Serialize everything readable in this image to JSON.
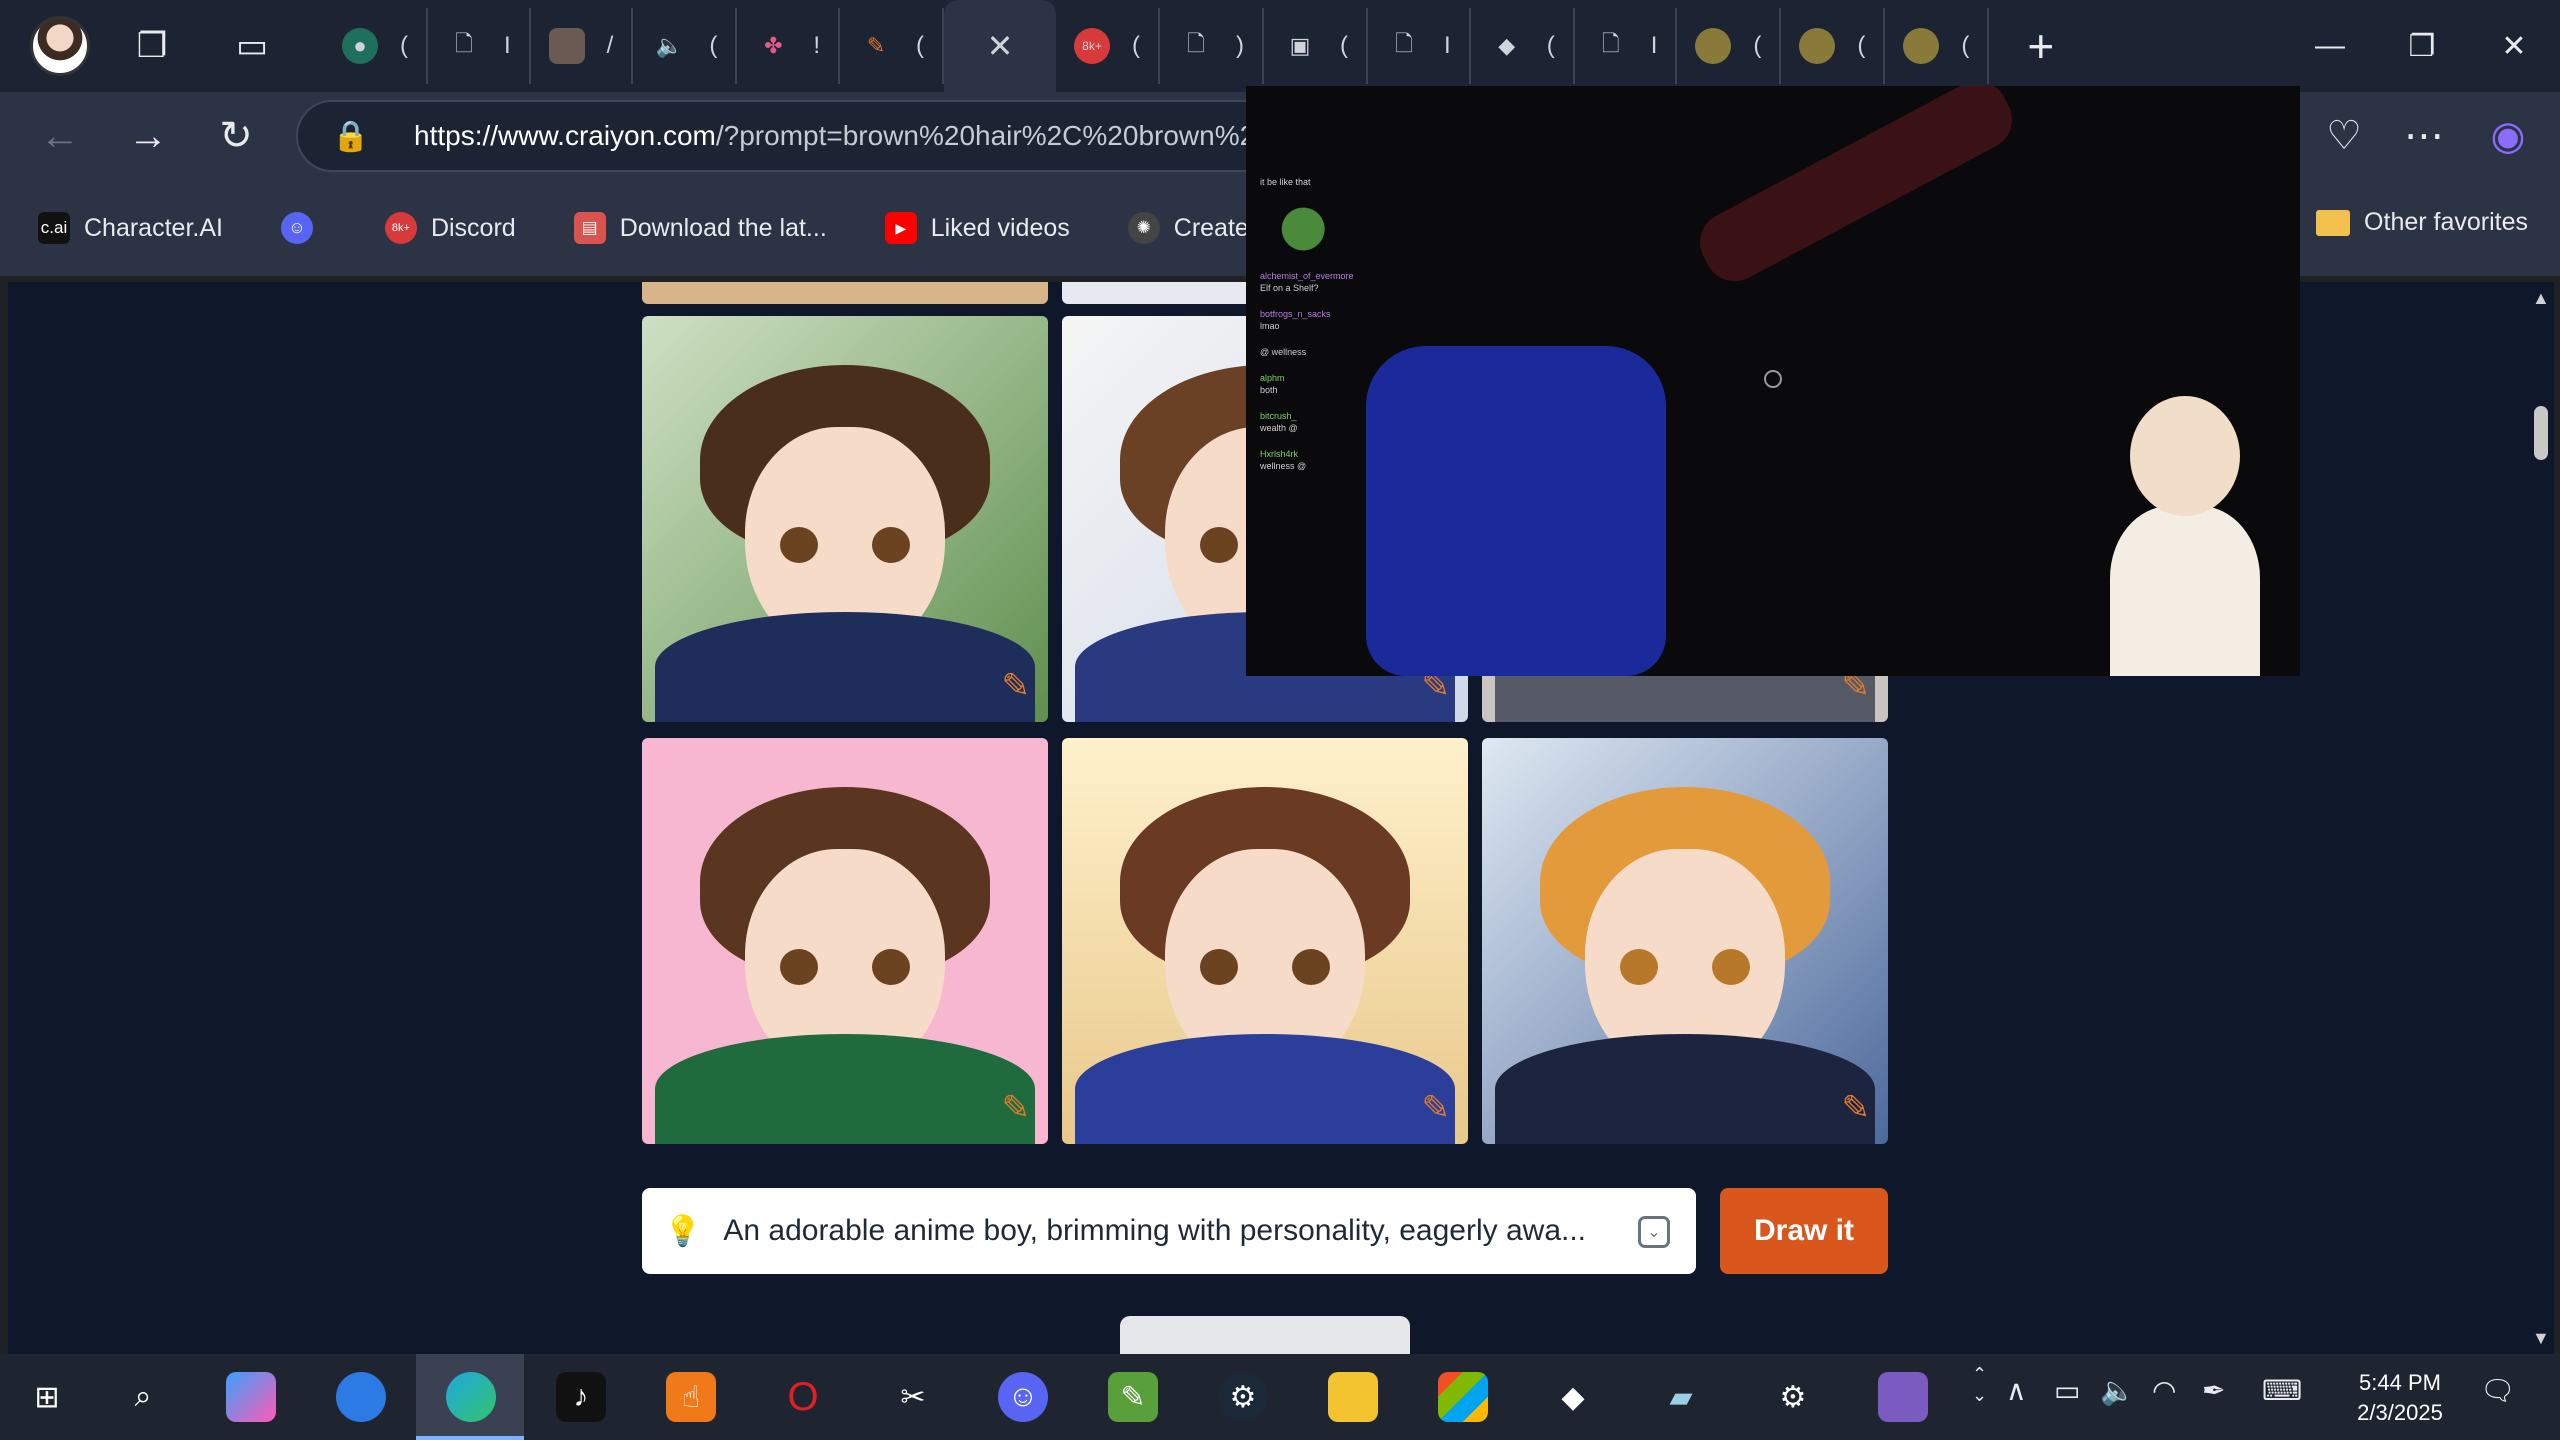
{
  "browser": {
    "tabs": [
      {
        "label": "(",
        "icon": "globe-icon"
      },
      {
        "label": "I",
        "icon": "page-icon"
      },
      {
        "label": "/",
        "icon": "image-icon"
      },
      {
        "label": "(",
        "icon": "speaker-icon"
      },
      {
        "label": "!",
        "icon": "pinwheel-icon"
      },
      {
        "label": "(",
        "icon": "pen-icon"
      },
      {
        "label": "",
        "icon": "close-icon",
        "active": true
      },
      {
        "label": "(",
        "icon": "discord-icon",
        "badge": "8k+"
      },
      {
        "label": ")",
        "icon": "page-icon"
      },
      {
        "label": "(",
        "icon": "video-icon"
      },
      {
        "label": "I",
        "icon": "page-icon"
      },
      {
        "label": "(",
        "icon": "roblox-icon"
      },
      {
        "label": "I",
        "icon": "page-icon"
      },
      {
        "label": "(",
        "icon": "mascot-icon"
      },
      {
        "label": "(",
        "icon": "mascot-icon"
      },
      {
        "label": "(",
        "icon": "mascot-icon"
      }
    ],
    "new_tab": "+",
    "url_host": "https://www.craiyon.com",
    "url_rest": "/?prompt=brown%20hair%2C%20brown%2",
    "favorites": [
      {
        "label": "Character.AI",
        "icon": "c.ai"
      },
      {
        "label": "",
        "icon": "discord-icon"
      },
      {
        "label": "Discord",
        "icon": "8k+"
      },
      {
        "label": "Download the lat...",
        "icon": "store-icon"
      },
      {
        "label": "Liked videos",
        "icon": "youtube-icon"
      },
      {
        "label": "Create Chara",
        "icon": "openai-icon"
      }
    ],
    "other_favorites": "Other favorites"
  },
  "page": {
    "prompt_text": "An adorable anime boy, brimming with personality, eagerly awa...",
    "draw_button": "Draw it"
  },
  "stream": {
    "chat": [
      {
        "user": "",
        "msg": "it be like that"
      },
      {
        "user": "",
        "msg": ""
      },
      {
        "user": "alchemist_of_evermore",
        "msg": "Elf on a Shelf?"
      },
      {
        "user": "botfrogs_n_sacks",
        "msg": "lmao"
      },
      {
        "user": "",
        "msg": "@ wellness"
      },
      {
        "user": "alphm",
        "msg": "both"
      },
      {
        "user": "bitcrush_",
        "msg": "wealth @"
      },
      {
        "user": "Hxrlsh4rk",
        "msg": "wellness @"
      }
    ]
  },
  "taskbar": {
    "time": "5:44 PM",
    "date": "2/3/2025"
  }
}
